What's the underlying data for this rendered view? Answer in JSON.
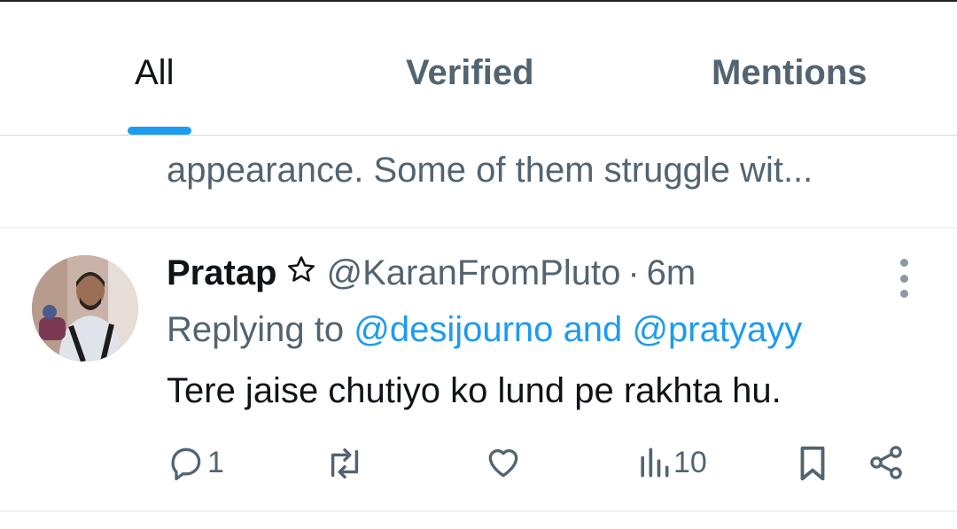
{
  "tabs": [
    {
      "label": "All",
      "active": true
    },
    {
      "label": "Verified",
      "active": false
    },
    {
      "label": "Mentions",
      "active": false
    }
  ],
  "previous_tweet": {
    "cut_line": "appearance. Some of them struggle wit...",
    "last_line": "appearance. Some of them struggle wit..."
  },
  "tweet": {
    "display_name": "Pratap",
    "name_symbol": "☆",
    "handle": "@KaranFromPluto",
    "separator": "·",
    "time": "6m",
    "replying_prefix": "Replying to",
    "mention_1": "@desijourno",
    "mention_joiner": "and",
    "mention_2": "@pratyayy",
    "text": "Tere jaise chutiyo ko lund pe rakhta hu.",
    "actions": {
      "reply_count": "1",
      "retweet_count": "",
      "like_count": "",
      "views_count": "10"
    }
  },
  "colors": {
    "accent": "#1d9bf0",
    "muted": "#536471",
    "text": "#0f1419",
    "divider": "#eff3f4"
  },
  "icons": [
    "reply-icon",
    "retweet-icon",
    "like-icon",
    "views-icon",
    "bookmark-icon",
    "share-icon",
    "more-icon"
  ]
}
